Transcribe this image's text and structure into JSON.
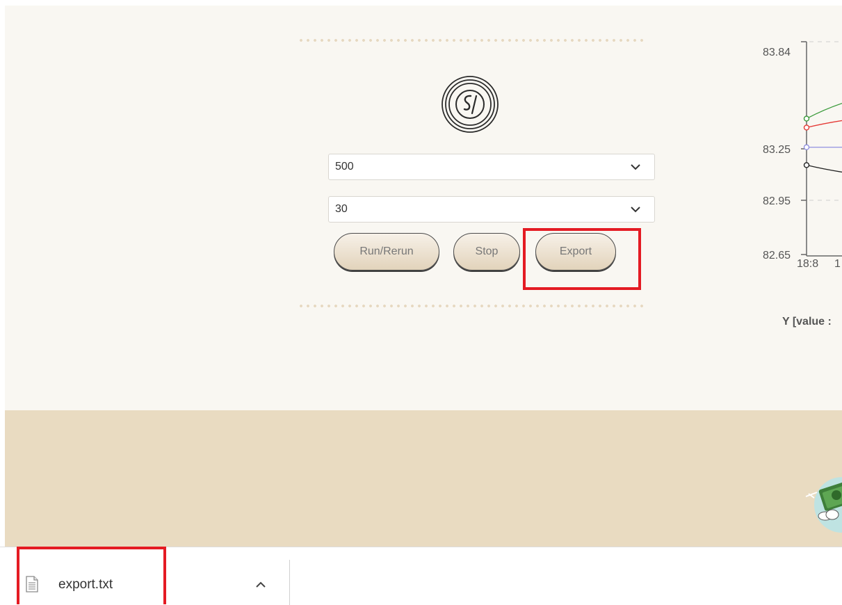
{
  "controls": {
    "select_count": {
      "value": "500"
    },
    "select_interval": {
      "value": "30"
    },
    "buttons": {
      "run": "Run/Rerun",
      "stop": "Stop",
      "export": "Export"
    }
  },
  "chart_data": {
    "type": "line",
    "yticks": [
      "83.84",
      "83.25",
      "82.95",
      "82.65"
    ],
    "xticks": [
      "18:8",
      "1"
    ],
    "ylabel": "Y [value :",
    "series": [
      {
        "color": "#3a9a3a",
        "values": [
          83.41
        ]
      },
      {
        "color": "#e53935",
        "values": [
          83.36
        ]
      },
      {
        "color": "#8f8fe0",
        "values": [
          83.25
        ]
      },
      {
        "color": "#222222",
        "values": [
          83.15
        ]
      }
    ]
  },
  "downloads": {
    "file_name": "export.txt"
  },
  "colors": {
    "highlight": "#e41b23",
    "footer": "#e9dbc1",
    "page": "#f9f7f2"
  }
}
